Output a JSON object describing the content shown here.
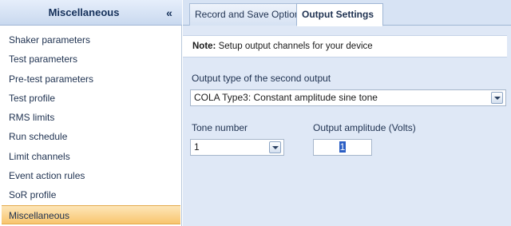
{
  "sidebar": {
    "title": "Miscellaneous",
    "collapse_glyph": "«",
    "items": [
      {
        "label": "Shaker parameters"
      },
      {
        "label": "Test parameters"
      },
      {
        "label": "Pre-test parameters"
      },
      {
        "label": "Test profile"
      },
      {
        "label": "RMS limits"
      },
      {
        "label": "Run schedule"
      },
      {
        "label": "Limit channels"
      },
      {
        "label": "Event action rules"
      },
      {
        "label": "SoR profile"
      },
      {
        "label": "Miscellaneous",
        "active": true
      }
    ]
  },
  "tabs": [
    {
      "label": "Record and Save Options",
      "active": false
    },
    {
      "label": "Output Settings",
      "active": true
    }
  ],
  "note": {
    "prefix": "Note:",
    "text": " Setup output channels for your device"
  },
  "output_type": {
    "label": "Output type of the second output",
    "value": "COLA Type3: Constant amplitude sine tone"
  },
  "tone_number": {
    "label": "Tone number",
    "value": "1"
  },
  "output_amplitude": {
    "label": "Output amplitude (Volts)",
    "value": "1"
  },
  "colors": {
    "active_item": "#f8c56e",
    "panel_bg": "#dfe8f6",
    "header_text": "#15305a"
  }
}
